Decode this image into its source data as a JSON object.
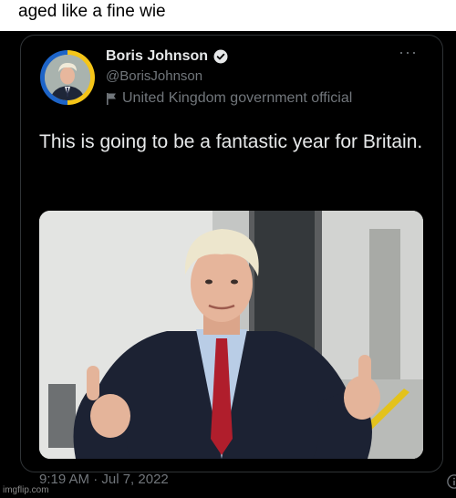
{
  "caption": "aged like a fine wie",
  "tweet": {
    "author_name": "Boris Johnson",
    "handle": "@BorisJohnson",
    "label": "United Kingdom government official",
    "text": "This is going to be a fantastic year for Britain.",
    "timestamp": "9:19 AM · Jul 7, 2022",
    "more_menu": "···"
  },
  "watermark": "imgflip.com",
  "icons": {
    "verified": "verified-badge-icon",
    "government": "flag-icon",
    "more": "more-icon",
    "info": "info-icon"
  },
  "colors": {
    "background": "#000000",
    "text_primary": "#e7e9ea",
    "text_secondary": "#71767b",
    "avatar_ring_yellow": "#f5c518",
    "avatar_ring_blue": "#1d64c8"
  }
}
